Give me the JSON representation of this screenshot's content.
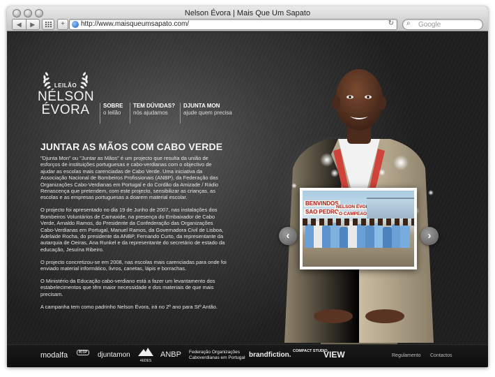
{
  "browser": {
    "title": "Nelson Évora | Mais Que Um Sapato",
    "url": "http://www.maisqueumsapato.com/",
    "search_placeholder": "Google",
    "back_icon": "◀",
    "forward_icon": "▶",
    "reload_icon": "↻",
    "add_tab_icon": "+"
  },
  "logo": {
    "top": "LEILÃO",
    "line1": "NÉLSON",
    "line2": "ÉVORA"
  },
  "nav": [
    {
      "title": "SOBRE",
      "subtitle": "o leilão"
    },
    {
      "title": "TEM DÚVIDAS?",
      "subtitle": "nós ajudamos"
    },
    {
      "title": "DJUNTA MON",
      "subtitle": "ajude quem precisa"
    }
  ],
  "article": {
    "heading": "JUNTAR AS MÃOS COM CABO VERDE",
    "paragraphs": [
      "\"Djunta Mon\" ou \"Juntar as Mãos\" é um projecto que resulta da união de esforços de instituições portuguesas e cabo-verdianas com o objectivo de ajudar as escolas mais carenciadas de Cabo Verde. Uma iniciativa da Associação Nacional de Bombeiros Profissionais (ANBP), da Federação das Organizações Cabo-Verdianas em Portugal e do Cordão da Amizade / Rádio Renascença que pretendem, com este projecto, sensibilizar as crianças, as escolas e as empresas portuguesas a doarem material escolar.",
      "O projecto foi apresentado no dia 19 de Junho de 2007, nas instalações dos Bombeiros Voluntários de Carnaxide, na presença do Embaixador de Cabo Verde, Arnaldo Ramos, do Presidente da Confederação das Organizações Cabo-Verdianas em Portugal, Manuel Ramos, da Governadora Civil de Lisboa, Adelaide Rocha, do presidente da ANBP, Fernando Curto, da representante da autarquia de Oeiras, Ana Runkel e da representante do secretário de estado da educação, Jesuína Ribeiro.",
      "O projecto concretizou-se em 2008, nas escolas mais carenciadas para onde foi enviado material informático, livros, canetas, lápis e borrachas.",
      "O Ministério da Educação cabo-verdiano está a fazer um levantamento dos estabelecimentos que têm maior necessidade e dos materiais de que mais precisam.",
      "A campanha tem como padrinho Nelson Évora, irá no 2º ano para Stº Antão."
    ]
  },
  "photo": {
    "banner1": "BENVINDOS",
    "banner2": "SAO PEDRO",
    "banner3": "NELSON ÉVORA",
    "banner4": "O CAMPEAO"
  },
  "carousel": {
    "prev_icon": "‹",
    "next_icon": "›"
  },
  "footer": {
    "sponsors": [
      "modalfa",
      "RTP",
      "djuntamon",
      "4EDES",
      "ANBP",
      "Federação Organizações",
      "Caboverdianas em Portugal",
      "brandfiction.",
      "COMPACT STUDIO",
      "VIEW"
    ],
    "links": [
      "Regulamento",
      "Contactos"
    ]
  },
  "colors": {
    "lanyard": "#d0433b",
    "jacket": "#c9bba0",
    "skin": "#5a3422"
  }
}
